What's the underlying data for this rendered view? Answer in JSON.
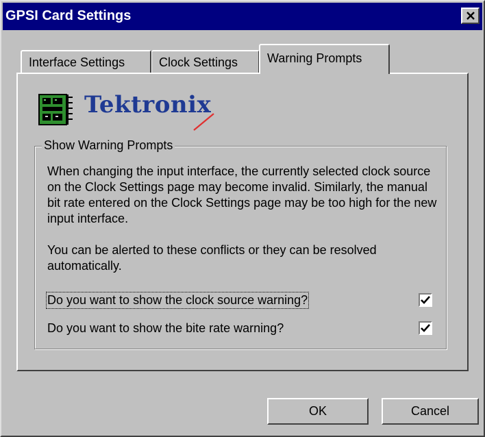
{
  "window": {
    "title": "GPSI Card Settings",
    "title_bar_color": "#000080",
    "face_color": "#c0c0c0"
  },
  "tabs": [
    {
      "label": "Interface Settings",
      "active": false
    },
    {
      "label": "Clock Settings",
      "active": false
    },
    {
      "label": "Warning Prompts",
      "active": true
    }
  ],
  "logo": {
    "text": "Tektronix",
    "icon": "circuit-card-icon",
    "color": "#1f3a93",
    "accent_color": "#e03030"
  },
  "group": {
    "legend": "Show Warning Prompts",
    "paragraph1": "When changing the input interface, the currently selected clock source on the Clock Settings page may become invalid. Similarly, the manual bit rate entered on the Clock Settings page may be too high for the new input interface.",
    "paragraph2": "You can be alerted to these conflicts or they can be resolved automatically.",
    "checks": [
      {
        "label": "Do you want to show the clock source warning?",
        "checked": true
      },
      {
        "label": "Do you want to show the bite rate warning?",
        "checked": true
      }
    ]
  },
  "buttons": {
    "ok": "OK",
    "cancel": "Cancel"
  }
}
